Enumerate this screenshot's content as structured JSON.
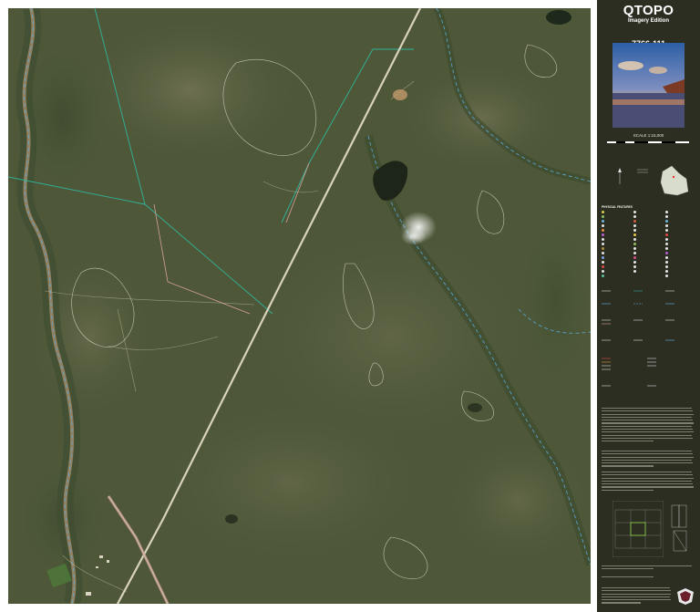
{
  "panel": {
    "brand": "QTOPO",
    "edition": "Imagery Edition",
    "sheet_number": "7766-111",
    "scale_text": "SCALE 1:15,000"
  },
  "legend": {
    "heading": "PHYSICAL FEATURES"
  },
  "colors": {
    "panel_bg": "#2c2e22",
    "cadastre_teal": "#2fb39a",
    "road_pink": "#d7a09a",
    "water_blue": "#5aa9d8",
    "contour_white": "#e8e4d4"
  }
}
